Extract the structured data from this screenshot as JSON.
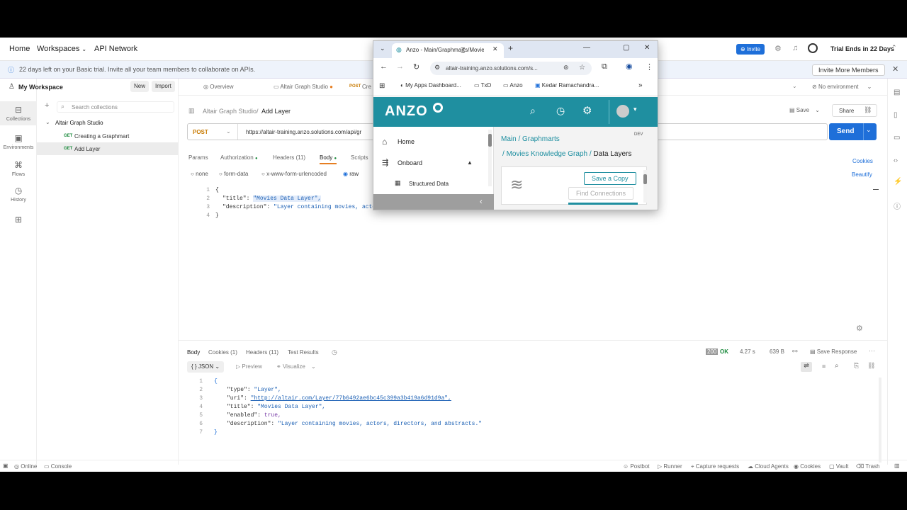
{
  "topnav": {
    "home": "Home",
    "workspaces": "Workspaces",
    "api_network": "API Network",
    "invite": "Invite",
    "trial": "Trial Ends in 22 Days"
  },
  "banner": {
    "text": "22 days left on your Basic trial. Invite all your team members to collaborate on APIs.",
    "button": "Invite More Members"
  },
  "rail": {
    "collections": "Collections",
    "environments": "Environments",
    "flows": "Flows",
    "history": "History"
  },
  "sidebar": {
    "workspace": "My Workspace",
    "new": "New",
    "import": "Import",
    "search_placeholder": "Search collections",
    "collection": "Altair Graph Studio",
    "items": [
      {
        "method": "GET",
        "name": "Creating a Graphmart"
      },
      {
        "method": "GET",
        "name": "Add Layer"
      }
    ]
  },
  "tabs": {
    "overview": "Overview",
    "altair": "Altair Graph Studio",
    "post_prefix": "POST",
    "post_name": "Cre",
    "env": "No environment"
  },
  "request": {
    "breadcrumb_parent": "Altair Graph Studio",
    "breadcrumb_sep": "/",
    "breadcrumb_current": "Add Layer",
    "save": "Save",
    "share": "Share",
    "method": "POST",
    "url": "https://altair-training.anzo.solutions.com/api/gr",
    "send": "Send",
    "subtabs": {
      "params": "Params",
      "authorization": "Authorization",
      "headers": "Headers (11)",
      "body": "Body",
      "scripts": "Scripts"
    },
    "cookies": "Cookies",
    "beautify": "Beautify",
    "body_types": {
      "none": "none",
      "form_data": "form-data",
      "urlencoded": "x-www-form-urlencoded",
      "raw": "raw"
    },
    "body_lines": [
      {
        "n": "1",
        "text": "{"
      },
      {
        "n": "2",
        "key": "\"title\"",
        "val": "\"Movies Data Layer\","
      },
      {
        "n": "3",
        "key": "\"description\"",
        "val": "\"Layer containing movies, actors, directors and abstracts.\""
      },
      {
        "n": "4",
        "text": "}"
      }
    ]
  },
  "response": {
    "tabs": {
      "body": "Body",
      "cookies": "Cookies (1)",
      "headers": "Headers (11)",
      "tests": "Test Results"
    },
    "status_code": "200",
    "status_text": "OK",
    "time": "4.27 s",
    "size": "639 B",
    "save": "Save Response",
    "format": "JSON",
    "preview": "Preview",
    "visualize": "Visualize",
    "lines": [
      {
        "n": "1",
        "text": "{"
      },
      {
        "n": "2",
        "key": "\"type\"",
        "val": "\"Layer\","
      },
      {
        "n": "3",
        "key": "\"uri\"",
        "val": "\"http://altair.com/Layer/77b6492ae6bc45c399a3b419a6d91d9a\","
      },
      {
        "n": "4",
        "key": "\"title\"",
        "val": "\"Movies Data Layer\","
      },
      {
        "n": "5",
        "key": "\"enabled\"",
        "val": "true,"
      },
      {
        "n": "6",
        "key": "\"description\"",
        "val": "\"Layer containing movies, actors, directors, and abstracts.\""
      },
      {
        "n": "7",
        "text": "}"
      }
    ]
  },
  "statusbar": {
    "online": "Online",
    "console": "Console",
    "postbot": "Postbot",
    "runner": "Runner",
    "capture": "Capture requests",
    "agents": "Cloud Agents",
    "cookies": "Cookies",
    "vault": "Vault",
    "trash": "Trash"
  },
  "browser": {
    "tab_title": "Anzo - Main/Graphmarts/Movie",
    "url": "altair-training.anzo.solutions.com/s...",
    "bookmarks": [
      "My Apps Dashboard...",
      "TxD",
      "Anzo",
      "Kedar Ramachandra..."
    ],
    "more": "»",
    "logo": "ANZO",
    "nav": {
      "home": "Home",
      "onboard": "Onboard",
      "structured": "Structured Data"
    },
    "breadcrumb1": "Main / Graphmarts",
    "dev": "DEV",
    "breadcrumb2_prefix": "/ ",
    "breadcrumb2_link": "Movies Knowledge Graph",
    "breadcrumb2_sep": " / ",
    "breadcrumb2_current": "Data Layers",
    "save_copy": "Save a Copy",
    "find_connections": "Find Connections"
  }
}
